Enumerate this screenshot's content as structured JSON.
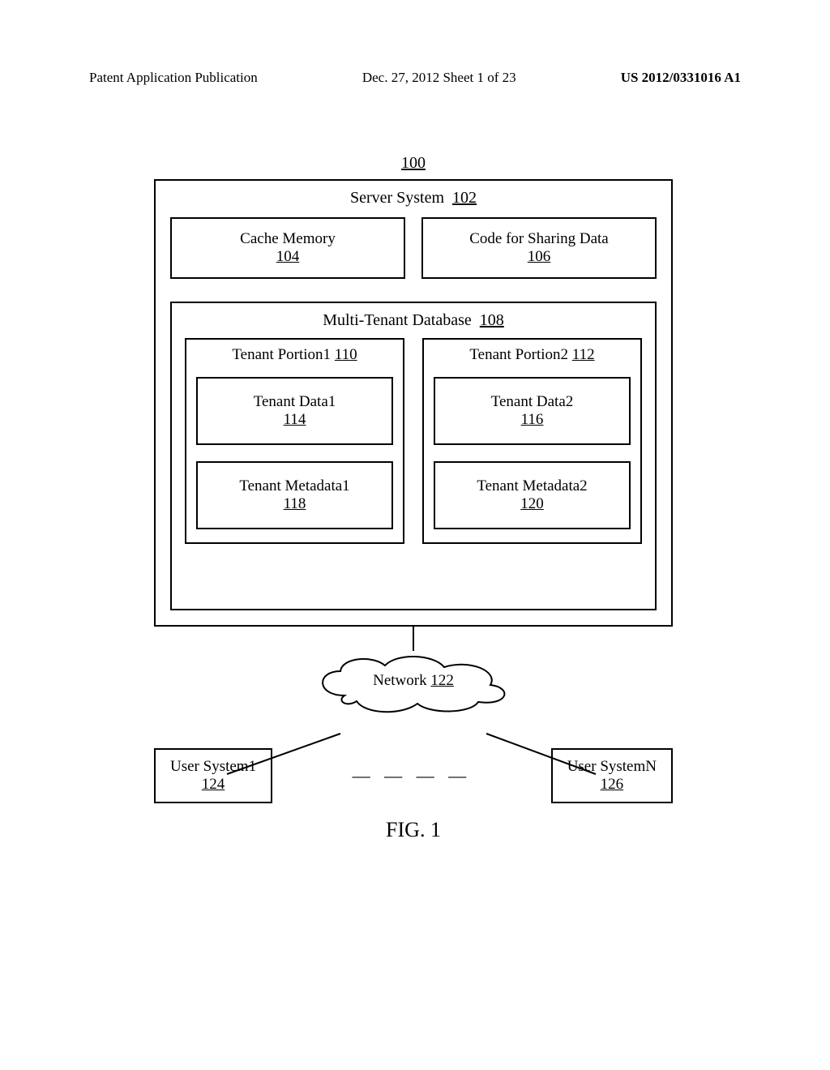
{
  "header": {
    "left": "Patent Application Publication",
    "mid": "Dec. 27, 2012  Sheet 1 of 23",
    "right": "US 2012/0331016 A1"
  },
  "figure": {
    "ref_overall": "100",
    "server_system": {
      "label": "Server System",
      "ref": "102"
    },
    "cache_memory": {
      "label": "Cache Memory",
      "ref": "104"
    },
    "code_share": {
      "label": "Code for Sharing Data",
      "ref": "106"
    },
    "mtdb": {
      "label": "Multi-Tenant Database",
      "ref": "108"
    },
    "tenant_portion1": {
      "label": "Tenant Portion1",
      "ref": "110"
    },
    "tenant_portion2": {
      "label": "Tenant Portion2",
      "ref": "112"
    },
    "tenant_data1": {
      "label": "Tenant Data1",
      "ref": "114"
    },
    "tenant_data2": {
      "label": "Tenant Data2",
      "ref": "116"
    },
    "tenant_meta1": {
      "label": "Tenant Metadata1",
      "ref": "118"
    },
    "tenant_meta2": {
      "label": "Tenant Metadata2",
      "ref": "120"
    },
    "network": {
      "label": "Network",
      "ref": "122"
    },
    "user_sys1": {
      "label": "User System1",
      "ref": "124"
    },
    "user_sysN": {
      "label": "User SystemN",
      "ref": "126"
    },
    "ellipsis": "— — — —",
    "caption": "FIG. 1"
  }
}
